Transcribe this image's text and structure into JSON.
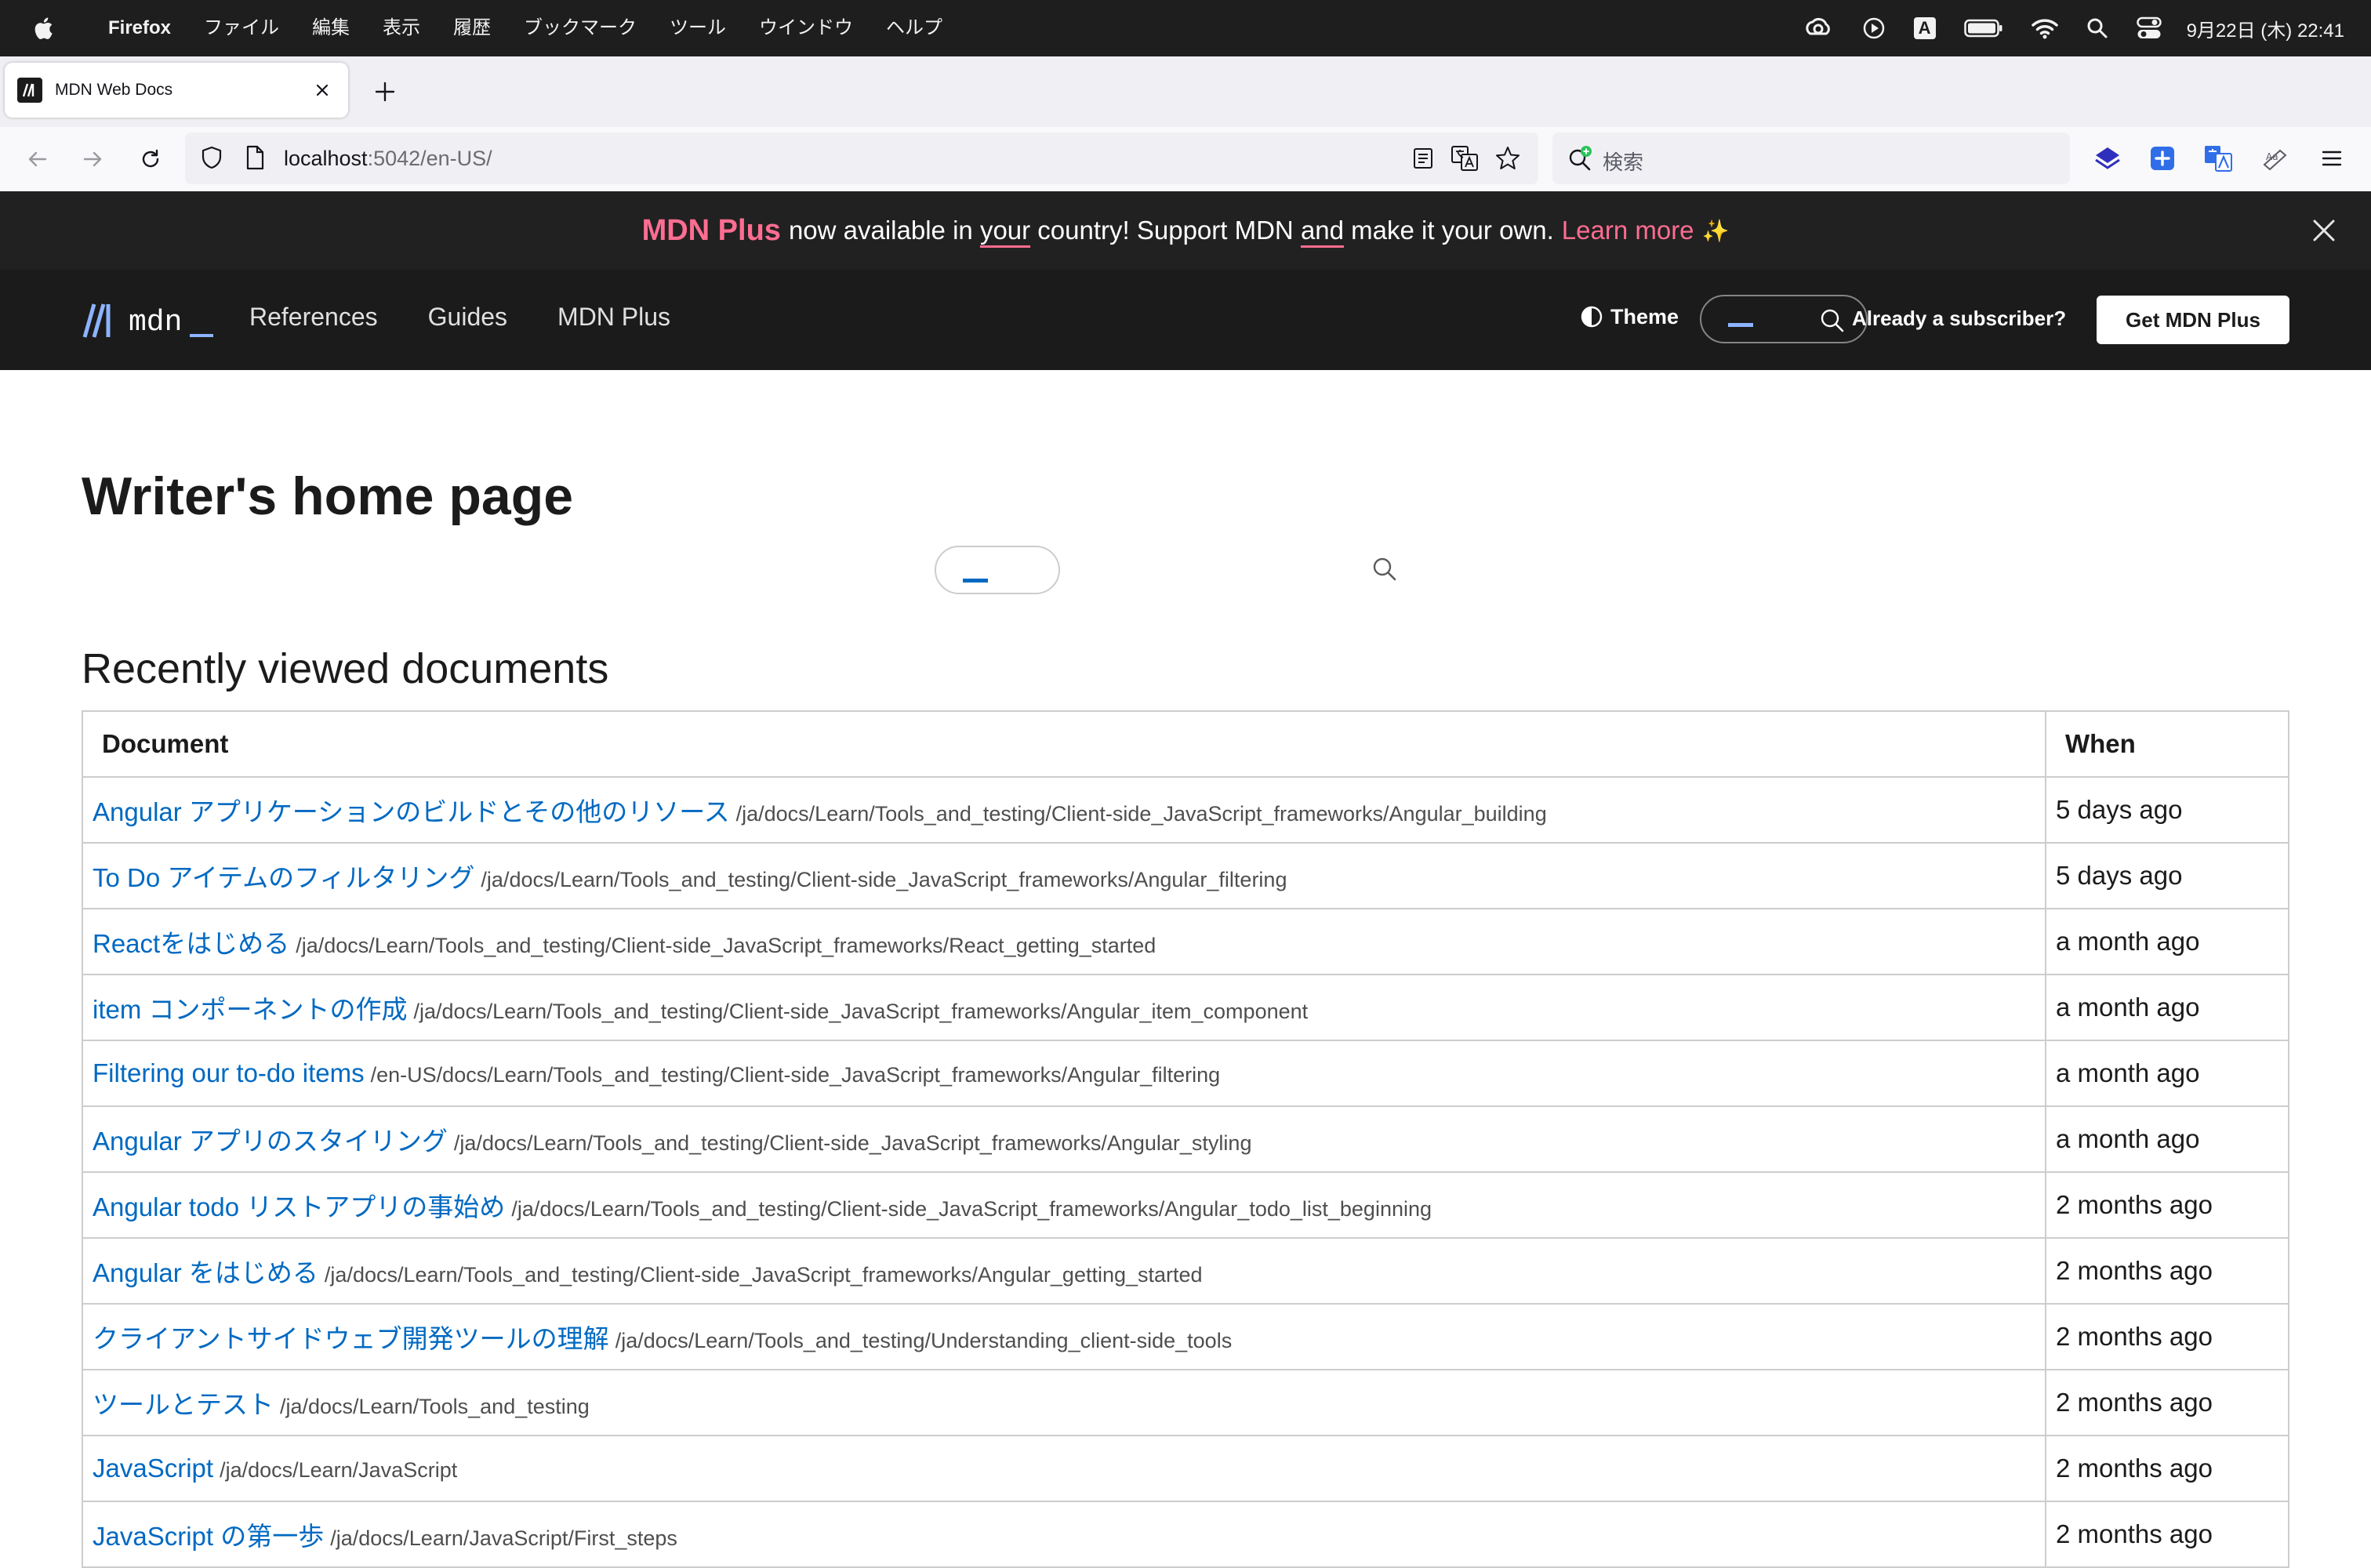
{
  "menubar": {
    "app_name": "Firefox",
    "items": [
      "ファイル",
      "編集",
      "表示",
      "履歴",
      "ブックマーク",
      "ツール",
      "ウインドウ",
      "ヘルプ"
    ],
    "ime_indicator": "A",
    "clock": "9月22日 (木)  22:41",
    "icons": [
      "apple-icon",
      "creative-cloud-icon",
      "play-icon",
      "input-method-icon",
      "battery-icon",
      "wifi-icon",
      "spotlight-icon",
      "control-center-icon"
    ]
  },
  "browser": {
    "tab_title": "MDN Web Docs",
    "url_host": "localhost",
    "url_rest": ":5042/en-US/",
    "search_placeholder": "検索"
  },
  "banner": {
    "brand": "MDN Plus",
    "text_1": "now available in ",
    "underline_1": "your",
    "text_2": " country! Support MDN ",
    "underline_2": "and",
    "text_3": " make it your own.",
    "learn_more": "Learn more",
    "sparkle": "✨"
  },
  "header": {
    "logo_text": "mdn",
    "nav": [
      "References",
      "Guides",
      "MDN Plus"
    ],
    "theme_label": "Theme",
    "already_subscriber": "Already a subscriber?",
    "get_plus": "Get MDN Plus"
  },
  "main": {
    "title": "Writer's home page",
    "recent_heading": "Recently viewed documents",
    "columns": [
      "Document",
      "When"
    ],
    "rows": [
      {
        "title": "Angular アプリケーションのビルドとその他のリソース",
        "path": "/ja/docs/Learn/Tools_and_testing/Client-side_JavaScript_frameworks/Angular_building",
        "when": "5 days ago"
      },
      {
        "title": "To Do アイテムのフィルタリング",
        "path": "/ja/docs/Learn/Tools_and_testing/Client-side_JavaScript_frameworks/Angular_filtering",
        "when": "5 days ago"
      },
      {
        "title": "Reactをはじめる",
        "path": "/ja/docs/Learn/Tools_and_testing/Client-side_JavaScript_frameworks/React_getting_started",
        "when": "a month ago"
      },
      {
        "title": "item コンポーネントの作成",
        "path": "/ja/docs/Learn/Tools_and_testing/Client-side_JavaScript_frameworks/Angular_item_component",
        "when": "a month ago"
      },
      {
        "title": "Filtering our to-do items",
        "path": "/en-US/docs/Learn/Tools_and_testing/Client-side_JavaScript_frameworks/Angular_filtering",
        "when": "a month ago"
      },
      {
        "title": "Angular アプリのスタイリング",
        "path": "/ja/docs/Learn/Tools_and_testing/Client-side_JavaScript_frameworks/Angular_styling",
        "when": "a month ago"
      },
      {
        "title": "Angular todo リストアプリの事始め",
        "path": "/ja/docs/Learn/Tools_and_testing/Client-side_JavaScript_frameworks/Angular_todo_list_beginning",
        "when": "2 months ago"
      },
      {
        "title": "Angular をはじめる",
        "path": "/ja/docs/Learn/Tools_and_testing/Client-side_JavaScript_frameworks/Angular_getting_started",
        "when": "2 months ago"
      },
      {
        "title": "クライアントサイドウェブ開発ツールの理解",
        "path": "/ja/docs/Learn/Tools_and_testing/Understanding_client-side_tools",
        "when": "2 months ago"
      },
      {
        "title": "ツールとテスト",
        "path": "/ja/docs/Learn/Tools_and_testing",
        "when": "2 months ago"
      },
      {
        "title": "JavaScript",
        "path": "/ja/docs/Learn/JavaScript",
        "when": "2 months ago"
      },
      {
        "title": "JavaScript の第一歩",
        "path": "/ja/docs/Learn/JavaScript/First_steps",
        "when": "2 months ago"
      }
    ]
  },
  "colors": {
    "accent_pink": "#ff6d91",
    "link_blue": "#0069c2",
    "header_bg": "#1b1b1b",
    "banner_bg": "#212121"
  }
}
